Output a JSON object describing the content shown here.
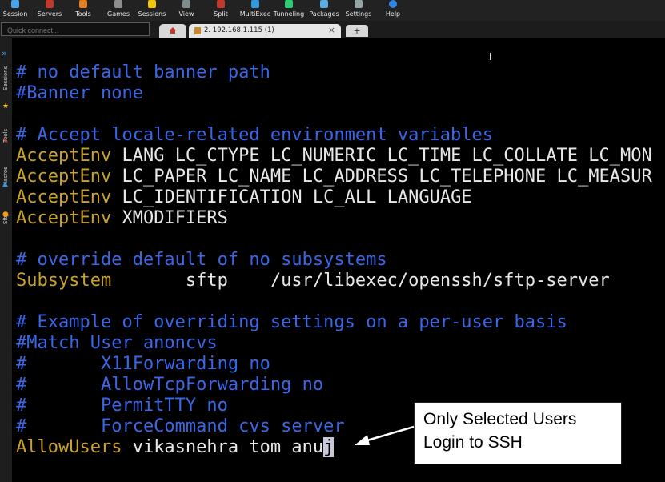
{
  "toolbar": {
    "items": [
      {
        "label": "Session",
        "icon": "session-icon",
        "color": "#4aa3e8"
      },
      {
        "label": "Servers",
        "icon": "servers-icon",
        "color": "#c0392b"
      },
      {
        "label": "Tools",
        "icon": "tools-icon",
        "color": "#e67e22"
      },
      {
        "label": "Games",
        "icon": "games-icon",
        "color": "#8e8e8e"
      },
      {
        "label": "Sessions",
        "icon": "sessions-star-icon",
        "color": "#f1c40f"
      },
      {
        "label": "View",
        "icon": "view-icon",
        "color": "#7f8c8d"
      },
      {
        "label": "Split",
        "icon": "split-icon",
        "color": "#c0392b"
      },
      {
        "label": "MultiExec",
        "icon": "multiexec-icon",
        "color": "#3498db"
      },
      {
        "label": "Tunneling",
        "icon": "tunneling-icon",
        "color": "#2ecc71"
      },
      {
        "label": "Packages",
        "icon": "packages-icon",
        "color": "#5dade2"
      },
      {
        "label": "Settings",
        "icon": "settings-icon",
        "color": "#95a5a6"
      },
      {
        "label": "Help",
        "icon": "help-icon",
        "color": "#2e86de"
      }
    ]
  },
  "quick_connect": {
    "placeholder": "Quick connect..."
  },
  "tabs": {
    "active_label": "2. 192.168.1.115 (1)",
    "close_glyph": "×",
    "new_tab_glyph": "+"
  },
  "side_rail": {
    "chevron": "»",
    "items": [
      "Sessions",
      "Tools",
      "Macros",
      "Sftp"
    ]
  },
  "terminal": {
    "lines": [
      {
        "kind": "comment",
        "text": "# no default banner path"
      },
      {
        "kind": "comment",
        "text": "#Banner none"
      },
      {
        "kind": "blank",
        "text": ""
      },
      {
        "kind": "comment",
        "text": "# Accept locale-related environment variables"
      },
      {
        "kind": "directive",
        "key": "AcceptEnv",
        "value": " LANG LC_CTYPE LC_NUMERIC LC_TIME LC_COLLATE LC_MON"
      },
      {
        "kind": "directive",
        "key": "AcceptEnv",
        "value": " LC_PAPER LC_NAME LC_ADDRESS LC_TELEPHONE LC_MEASUR"
      },
      {
        "kind": "directive",
        "key": "AcceptEnv",
        "value": " LC_IDENTIFICATION LC_ALL LANGUAGE"
      },
      {
        "kind": "directive",
        "key": "AcceptEnv",
        "value": " XMODIFIERS"
      },
      {
        "kind": "blank",
        "text": ""
      },
      {
        "kind": "comment",
        "text": "# override default of no subsystems"
      },
      {
        "kind": "directive",
        "key": "Subsystem",
        "value": "       sftp    /usr/libexec/openssh/sftp-server"
      },
      {
        "kind": "blank",
        "text": ""
      },
      {
        "kind": "comment",
        "text": "# Example of overriding settings on a per-user basis"
      },
      {
        "kind": "comment",
        "text": "#Match User anoncvs"
      },
      {
        "kind": "comment",
        "text": "#       X11Forwarding no"
      },
      {
        "kind": "comment",
        "text": "#       AllowTcpForwarding no"
      },
      {
        "kind": "comment",
        "text": "#       PermitTTY no"
      },
      {
        "kind": "comment",
        "text": "#       ForceCommand cvs server"
      },
      {
        "kind": "directive_cursor",
        "key": "AllowUsers",
        "value": " vikasnehra tom anu",
        "cursor_char": "j"
      }
    ]
  },
  "callout": {
    "line1": "Only Selected Users",
    "line2": "Login to SSH"
  },
  "colors": {
    "comment": "#3a66e8",
    "keyword": "#c9a227",
    "text": "#e8e8e8",
    "background": "#000000"
  }
}
